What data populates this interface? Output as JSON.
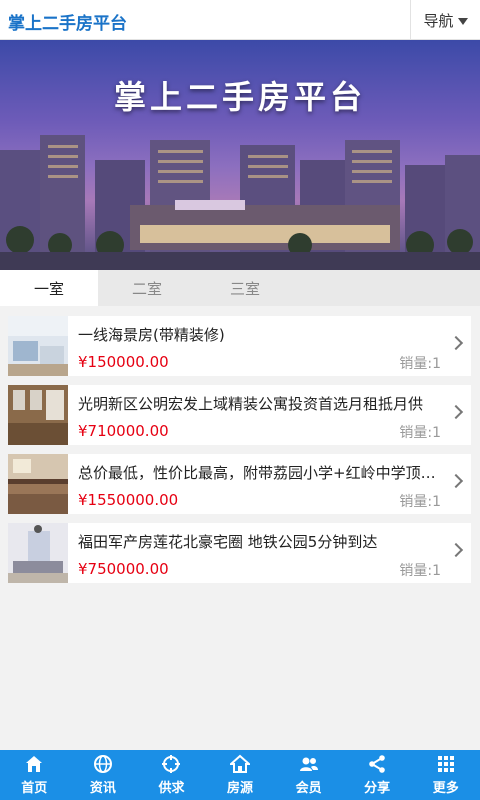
{
  "header": {
    "title": "掌上二手房平台",
    "nav_label": "导航"
  },
  "banner": {
    "title": "掌上二手房平台"
  },
  "tabs": [
    {
      "label": "一室",
      "active": true
    },
    {
      "label": "二室",
      "active": false
    },
    {
      "label": "三室",
      "active": false
    }
  ],
  "listings": [
    {
      "title": "一线海景房(带精装修)",
      "price": "¥150000.00",
      "sales": "销量:1"
    },
    {
      "title": "光明新区公明宏发上域精装公寓投资首选月租抵月供",
      "price": "¥710000.00",
      "sales": "销量:1"
    },
    {
      "title": "总价最低，性价比最高，附带荔园小学+红岭中学顶级学位",
      "price": "¥1550000.00",
      "sales": "销量:1"
    },
    {
      "title": "福田军产房莲花北豪宅圈 地铁公园5分钟到达",
      "price": "¥750000.00",
      "sales": "销量:1"
    }
  ],
  "bottom_nav": [
    {
      "label": "首页",
      "icon": "home-icon"
    },
    {
      "label": "资讯",
      "icon": "globe-icon"
    },
    {
      "label": "供求",
      "icon": "target-icon"
    },
    {
      "label": "房源",
      "icon": "house-icon"
    },
    {
      "label": "会员",
      "icon": "members-icon"
    },
    {
      "label": "分享",
      "icon": "share-icon"
    },
    {
      "label": "更多",
      "icon": "grid-icon"
    }
  ],
  "colors": {
    "brand": "#1a73c8",
    "price": "#e60012",
    "bottom_bar": "#1b8fe6"
  }
}
